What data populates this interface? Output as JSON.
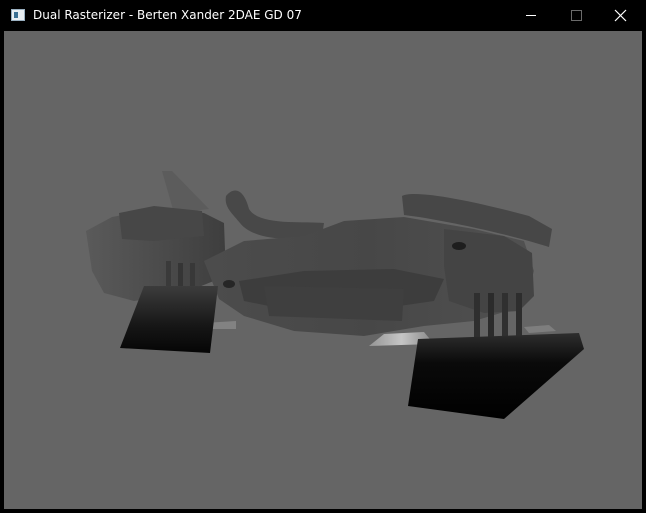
{
  "window": {
    "title": "Dual Rasterizer - Berten Xander 2DAE GD 07",
    "icon": "app-window-icon",
    "controls": {
      "minimize": "minimize-icon",
      "maximize": "maximize-icon",
      "close": "close-icon"
    }
  },
  "viewport": {
    "background_color": "#656565",
    "content": "depth-buffer-render-vehicle"
  }
}
